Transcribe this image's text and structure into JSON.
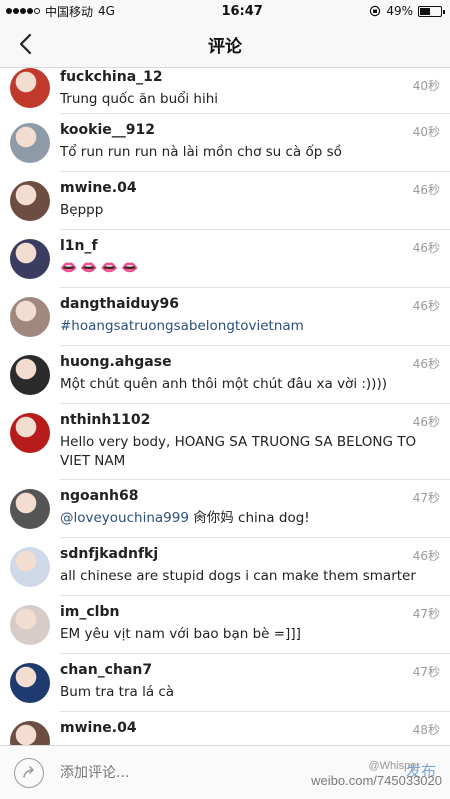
{
  "status_bar": {
    "carrier": "中国移动",
    "network": "4G",
    "time": "16:47",
    "battery_percent": "49%",
    "battery_level": 0.49
  },
  "nav": {
    "title": "评论",
    "back_icon": "chevron-left-icon"
  },
  "comments": [
    {
      "user": "fuckchina_12",
      "text": "Trung quốc ăn buổi hihi",
      "time": "40秒",
      "avatar_color": "#c0392b"
    },
    {
      "user": "kookie__912",
      "text": "Tổ run run run nà lài mồn chơ su cà ốp sồ",
      "time": "40秒",
      "avatar_color": "#8e9aa6"
    },
    {
      "user": "mwine.04",
      "text": "Bẹppp",
      "time": "46秒",
      "avatar_color": "#6d4c41"
    },
    {
      "user": "l1n_f",
      "text": "👄👄👄👄",
      "time": "46秒",
      "avatar_color": "#3c3c60"
    },
    {
      "user": "dangthaiduy96",
      "text": "#hoangsatruongsabelongtovietnam",
      "time": "46秒",
      "avatar_color": "#a1887f"
    },
    {
      "user": "huong.ahgase",
      "text": "Một chút quên anh thôi một chút đâu xa vời :))))",
      "time": "46秒",
      "avatar_color": "#2b2b2b"
    },
    {
      "user": "nthinh1102",
      "text": "Hello very body, HOANG SA TRUONG SA BELONG TO VIET NAM",
      "time": "46秒",
      "avatar_color": "#b71c1c"
    },
    {
      "user": "ngoanh68",
      "mention": "@loveyouchina999",
      "text": "肏你妈 china dog!",
      "time": "47秒",
      "avatar_color": "#555555"
    },
    {
      "user": "sdnfjkadnfkj",
      "text": "all chinese are stupid dogs i can make them smarter",
      "time": "46秒",
      "avatar_color": "#cfd8e6"
    },
    {
      "user": "im_clbn",
      "text": "EM yêu vịt nam với bao bạn bè =]]]",
      "time": "47秒",
      "avatar_color": "#d7ccc8"
    },
    {
      "user": "chan_chan7",
      "text": "Bum tra tra lá cà",
      "time": "47秒",
      "avatar_color": "#1e3a6e"
    },
    {
      "user": "mwine.04",
      "text": "",
      "time": "48秒",
      "avatar_color": "#6d4c41"
    }
  ],
  "input_bar": {
    "placeholder": "添加评论...",
    "send_label": "发布",
    "watermark_top": "@Whisper",
    "watermark": "weibo.com/745033020"
  }
}
